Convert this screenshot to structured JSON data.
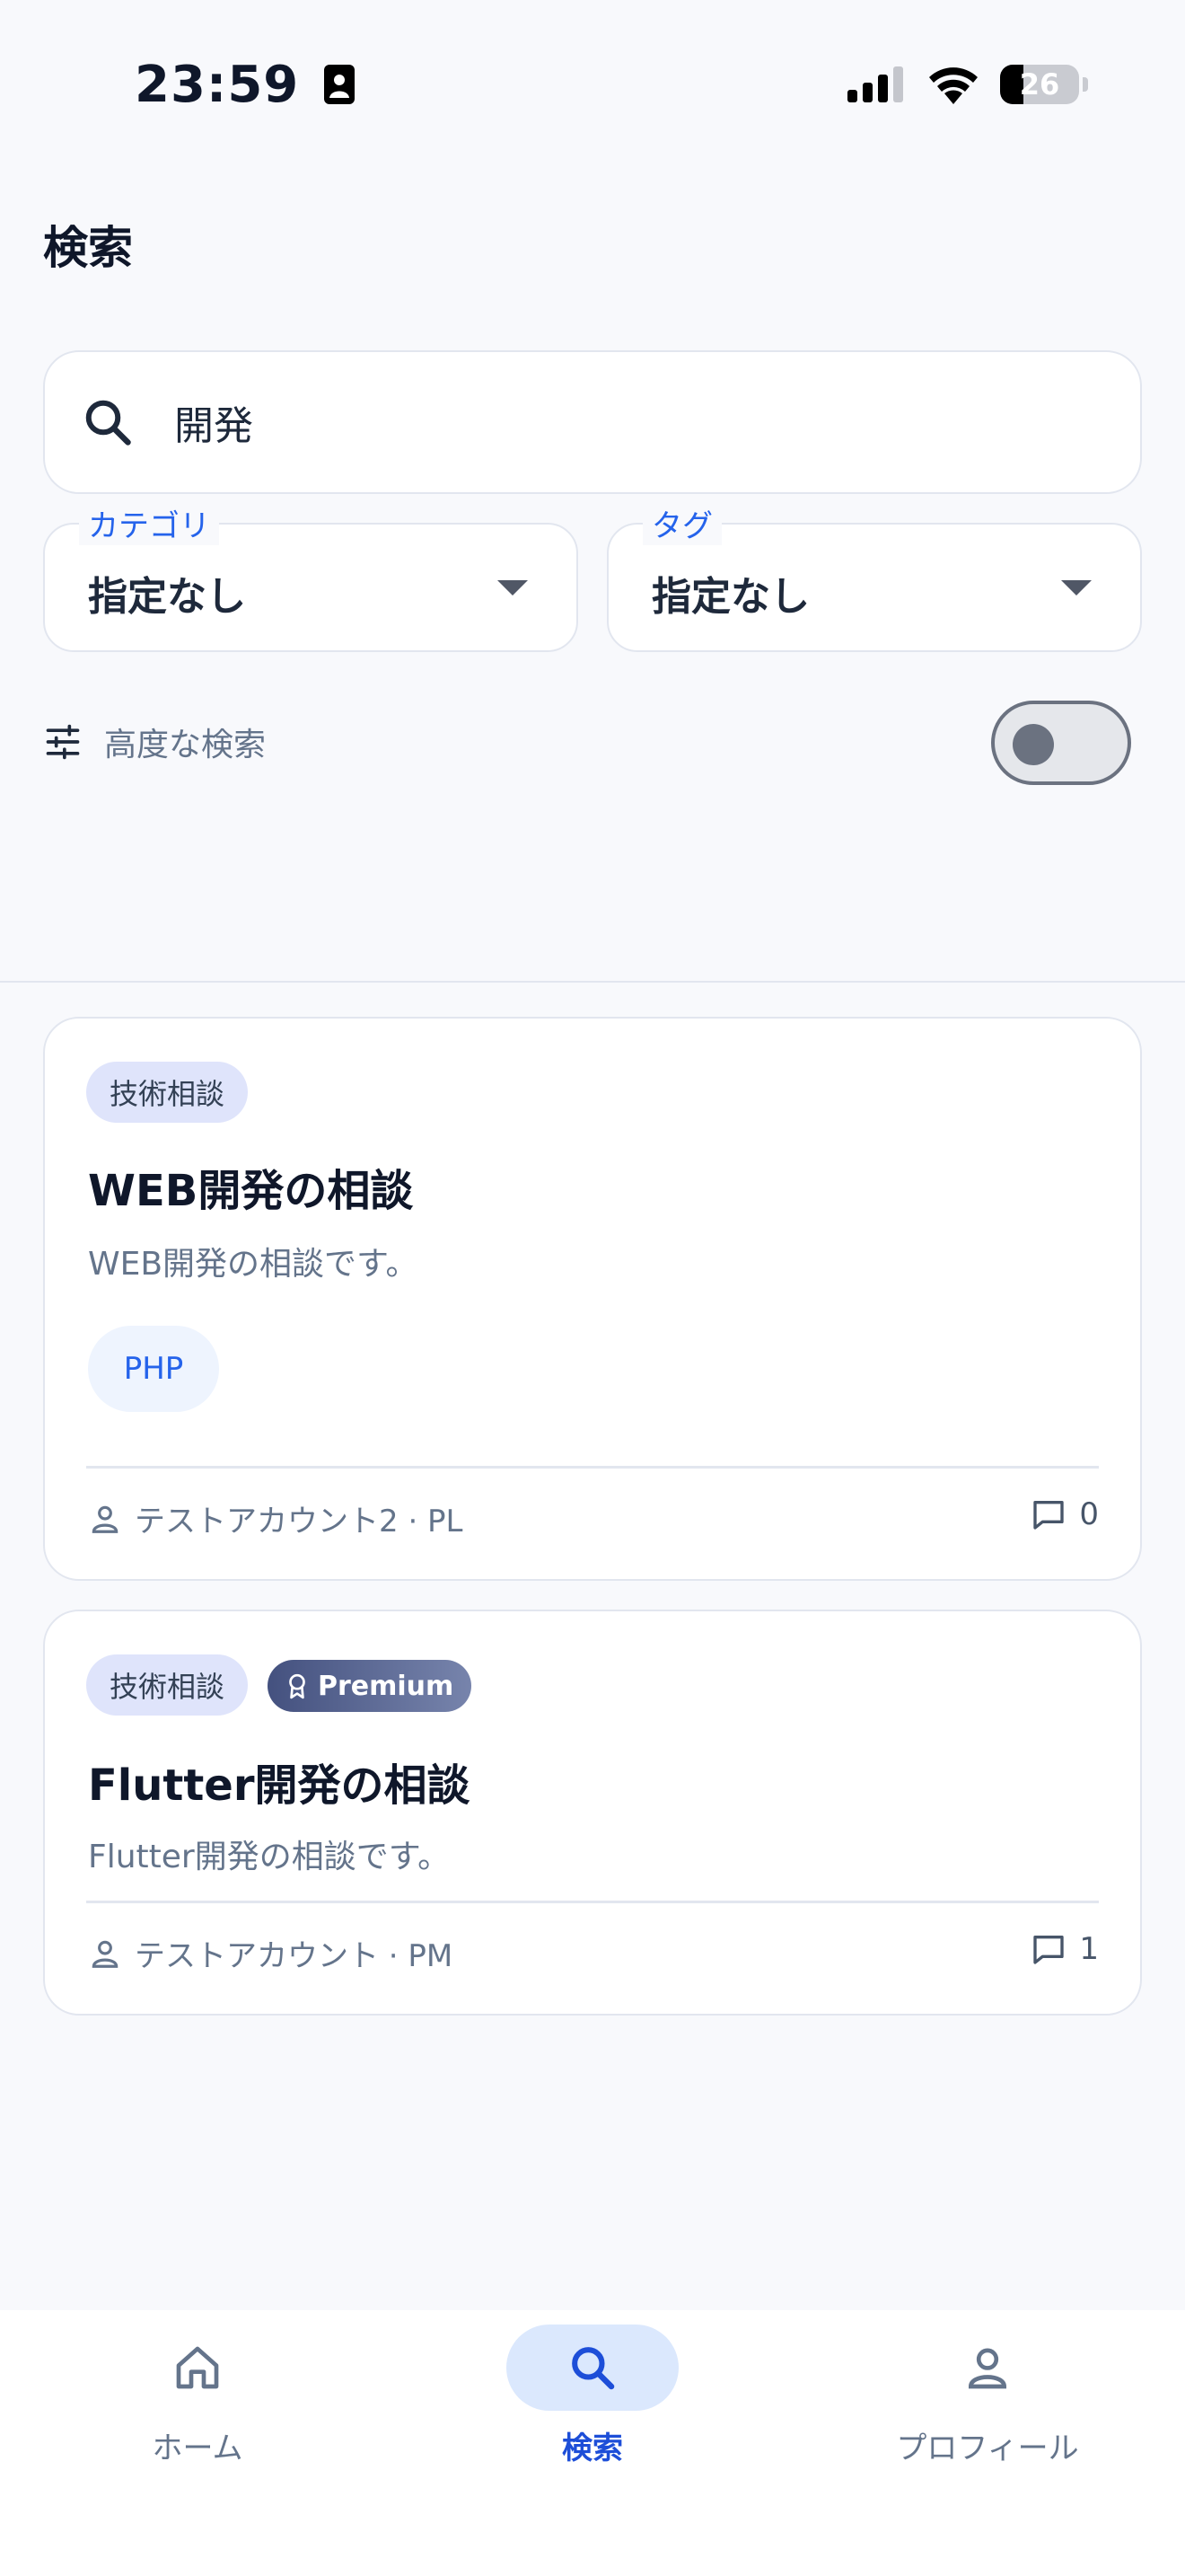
{
  "status_bar": {
    "time": "23:59",
    "battery": "26"
  },
  "header": {
    "title": "検索"
  },
  "search": {
    "value": "開発"
  },
  "filters": {
    "category": {
      "label": "カテゴリ",
      "value": "指定なし"
    },
    "tag": {
      "label": "タグ",
      "value": "指定なし"
    }
  },
  "advanced": {
    "label": "高度な検索",
    "enabled": false
  },
  "results": [
    {
      "category": "技術相談",
      "title": "WEB開発の相談",
      "description": "WEB開発の相談です。",
      "tag": "PHP",
      "author": "テストアカウント2 · PL",
      "comments": "0"
    },
    {
      "category": "技術相談",
      "badge": "Premium",
      "title": "Flutter開発の相談",
      "description": "Flutter開発の相談です。",
      "author": "テストアカウント · PM",
      "comments": "1"
    }
  ],
  "nav": {
    "home": "ホーム",
    "search": "検索",
    "profile": "プロフィール"
  },
  "colors": {
    "accent": "#2563eb",
    "background": "#f8f9fc",
    "premium": "#44517f"
  }
}
